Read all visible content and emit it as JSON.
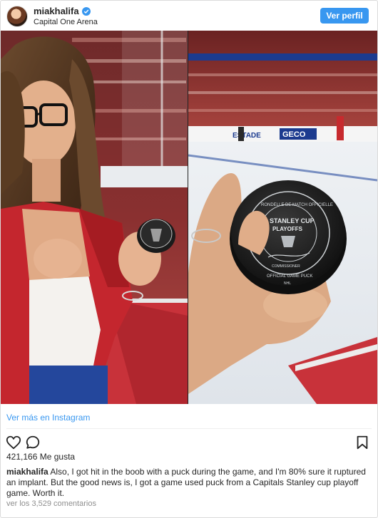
{
  "header": {
    "username": "miakhalifa",
    "location": "Capital One Arena",
    "view_profile_label": "Ver perfil"
  },
  "photo": {
    "left_board_text": [
      "GECO",
      "ESTADE"
    ],
    "right_puck_text": {
      "ring_top": "RONDELLE DE MATCH OFFICIELLE",
      "center_top": "STANLEY CUP",
      "center_bottom": "PLAYOFFS",
      "sign_label": "COMMISSIONER",
      "ring_bottom": "OFFICIAL GAME PUCK",
      "nhl": "NHL"
    }
  },
  "view_more": "Ver más en Instagram",
  "actions": {
    "icons": [
      "heart-icon",
      "comment-icon",
      "bookmark-icon"
    ]
  },
  "likes": "421,166 Me gusta",
  "caption": {
    "username": "miakhalifa",
    "text": "Also, I got hit in the boob with a puck during the game, and I'm 80% sure it ruptured an implant. But the good news is, I got a game used puck from a Capitals Stanley cup playoff game. Worth it."
  },
  "comments_link": "ver los 3,529 comentarios",
  "colors": {
    "accent": "#3897f0",
    "text": "#262626",
    "muted": "#8e8e8e"
  }
}
